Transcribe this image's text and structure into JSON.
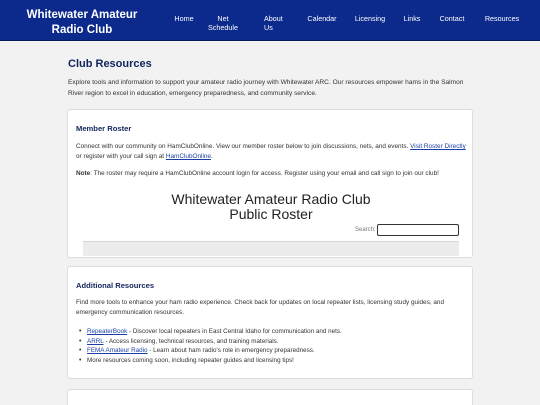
{
  "nav": {
    "brand": "Whitewater Amateur Radio Club",
    "items": [
      {
        "label": "Home"
      },
      {
        "label": "Net Schedule"
      },
      {
        "label": "About Us"
      },
      {
        "label": "Calendar"
      },
      {
        "label": "Licensing"
      },
      {
        "label": "Links"
      },
      {
        "label": "Contact"
      },
      {
        "label": "Resources"
      }
    ]
  },
  "page": {
    "title": "Club Resources",
    "intro": "Explore tools and information to support your amateur radio journey with Whitewater ARC. Our resources empower hams in the Salmon River region to excel in education, emergency preparedness, and community service."
  },
  "member_roster": {
    "heading": "Member Roster",
    "text_1": "Connect with our community on HamClubOnline. View our member roster below to join discussions, nets, and events.",
    "link_visit": "Visit Roster Directly",
    "text_2": "or register with your call sign at",
    "link_hamclub": "HamClubOnline",
    "text_3": ".",
    "note_label": "Note",
    "note_text": ": The roster may require a HamClubOnline account login for access. Register using your email and call sign to join our club!",
    "roster_title_1": "Whitewater Amateur Radio Club",
    "roster_title_2": "Public Roster",
    "search_label": "Search:",
    "search_value": ""
  },
  "additional_resources": {
    "heading": "Additional Resources",
    "text": "Find more tools to enhance your ham radio experience. Check back for updates on local repeater lists, licensing study guides, and emergency communication resources.",
    "items": [
      {
        "link": "RepeaterBook",
        "text": " - Discover local repeaters in East Central Idaho for communication and nets."
      },
      {
        "link": "ARRL",
        "text": " - Access licensing, technical resources, and training materials."
      },
      {
        "link": "FEMA Amateur Radio",
        "text": " - Learn about ham radio's role in emergency preparedness."
      },
      {
        "link": "",
        "text": "More resources coming soon, including repeater guides and licensing tips!"
      }
    ]
  },
  "colors": {
    "nav_bg": "#0b2a8c",
    "heading": "#13245c",
    "link": "#1b3fa6",
    "page_bg": "#f2f2f2"
  }
}
